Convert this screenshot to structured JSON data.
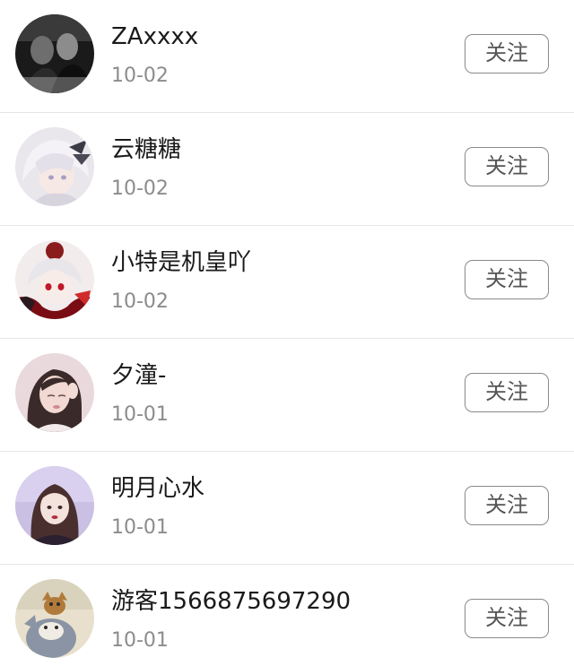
{
  "followers": [
    {
      "name": "ZAxxxx",
      "date": "10-02",
      "follow_label": "关注",
      "avatar": "avatar-bw-couple"
    },
    {
      "name": "云糖糖",
      "date": "10-02",
      "follow_label": "关注",
      "avatar": "avatar-anime-white-hair"
    },
    {
      "name": "小特是机皇吖",
      "date": "10-02",
      "follow_label": "关注",
      "avatar": "avatar-anime-red"
    },
    {
      "name": "夕潼-",
      "date": "10-01",
      "follow_label": "关注",
      "avatar": "avatar-girl-pink"
    },
    {
      "name": "明月心水",
      "date": "10-01",
      "follow_label": "关注",
      "avatar": "avatar-girl-lavender"
    },
    {
      "name": "游客1566875697290",
      "date": "10-01",
      "follow_label": "关注",
      "avatar": "avatar-cartoon-cat"
    }
  ]
}
